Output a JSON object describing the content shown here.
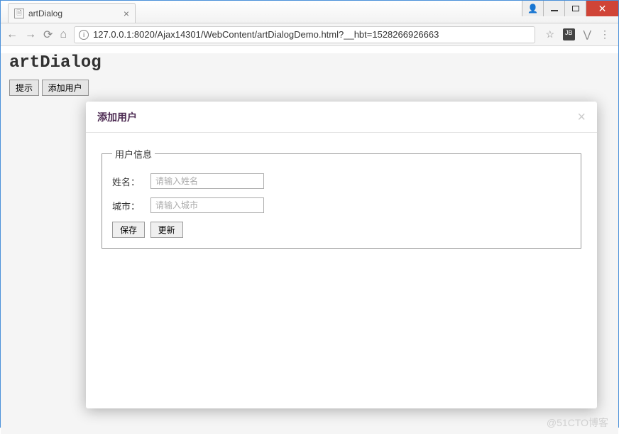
{
  "browser": {
    "tab_title": "artDialog",
    "url": "127.0.0.1:8020/Ajax14301/WebContent/artDialogDemo.html?__hbt=1528266926663"
  },
  "page": {
    "heading": "artDialog",
    "buttons": {
      "tip": "提示",
      "add_user": "添加用户"
    }
  },
  "dialog": {
    "title": "添加用户",
    "fieldset_legend": "用户信息",
    "form": {
      "name_label": "姓名：",
      "name_placeholder": "请输入姓名",
      "city_label": "城市：",
      "city_placeholder": "请输入城市",
      "save": "保存",
      "update": "更新"
    }
  },
  "watermark": "@51CTO博客"
}
